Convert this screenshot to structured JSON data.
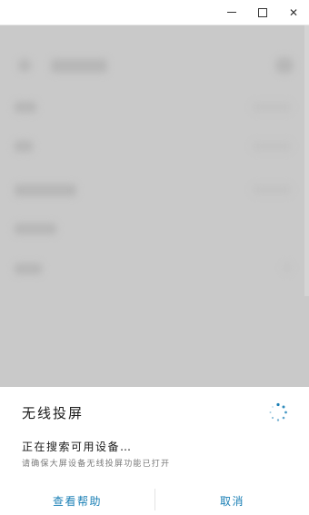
{
  "window_controls": {
    "minimize_icon": "minimize-icon",
    "maximize_icon": "maximize-icon",
    "close_symbol": "✕"
  },
  "cast_sheet": {
    "title": "无线投屏",
    "status": "正在搜索可用设备…",
    "hint": "请确保大屏设备无线投屏功能已打开",
    "help_button": "查看帮助",
    "cancel_button": "取消",
    "spinner_icon": "loading-spinner-icon",
    "accent_color": "#1a7fb5"
  }
}
